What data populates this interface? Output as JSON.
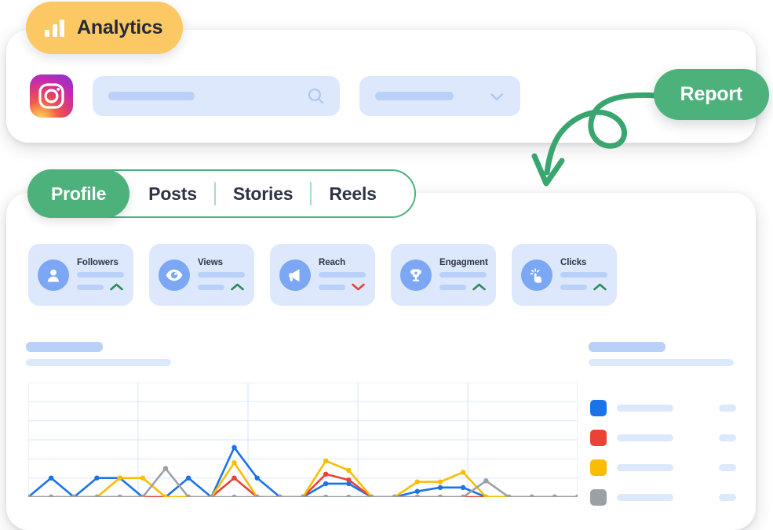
{
  "badge": {
    "label": "Analytics",
    "icon": "bar-chart-icon",
    "bg_color": "#fcc863"
  },
  "top_panel": {
    "platform_icon": "instagram-icon",
    "search": {
      "icon": "search-icon",
      "value": "",
      "placeholder": ""
    },
    "dropdown": {
      "icon": "chevron-down-icon",
      "value": ""
    },
    "report_button": {
      "label": "Report",
      "color": "#4cb17b"
    },
    "arrow": {
      "name": "curved-arrow-annotation",
      "color": "#3aa66f"
    }
  },
  "tabs": [
    {
      "label": "Profile",
      "active": true
    },
    {
      "label": "Posts",
      "active": false
    },
    {
      "label": "Stories",
      "active": false
    },
    {
      "label": "Reels",
      "active": false
    }
  ],
  "stat_cards": [
    {
      "label": "Followers",
      "icon": "user-icon",
      "trend": "up",
      "trend_color": "#2e8b57"
    },
    {
      "label": "Views",
      "icon": "eye-icon",
      "trend": "up",
      "trend_color": "#2e8b57"
    },
    {
      "label": "Reach",
      "icon": "megaphone-icon",
      "trend": "down",
      "trend_color": "#e8413a"
    },
    {
      "label": "Engagment",
      "icon": "trophy-icon",
      "trend": "up",
      "trend_color": "#2e8b57"
    },
    {
      "label": "Clicks",
      "icon": "tap-click-icon",
      "trend": "up",
      "trend_color": "#2e8b57"
    }
  ],
  "chart_data": {
    "type": "line",
    "title": "",
    "subtitle": "",
    "xlabel": "",
    "ylabel": "",
    "grid": true,
    "grid_rows": 6,
    "grid_cols": 5,
    "xlim": [
      0,
      24
    ],
    "ylim": [
      0,
      6
    ],
    "legend_position": "right",
    "x": [
      0,
      1,
      2,
      3,
      4,
      5,
      6,
      7,
      8,
      9,
      10,
      11,
      12,
      13,
      14,
      15,
      16,
      17,
      18,
      19,
      20,
      21,
      22,
      23,
      24
    ],
    "series": [
      {
        "name": "",
        "color": "#1a73e8",
        "values": [
          0,
          1,
          0,
          1,
          1,
          0,
          0,
          1,
          0,
          2.6,
          1,
          0,
          0,
          0.7,
          0.7,
          0,
          0,
          0.3,
          0.5,
          0.5,
          0,
          0,
          0,
          0,
          0
        ]
      },
      {
        "name": "",
        "color": "#ea4335",
        "values": [
          0,
          0,
          0,
          0,
          0,
          0,
          0,
          0,
          0,
          1,
          0,
          0,
          0,
          1.2,
          0.9,
          0,
          0,
          0,
          0,
          0,
          0,
          0,
          0,
          0,
          0
        ]
      },
      {
        "name": "",
        "color": "#fbbc04",
        "values": [
          0,
          0,
          0,
          0,
          1,
          1,
          0,
          0,
          0,
          1.8,
          0,
          0,
          0,
          1.9,
          1.4,
          0,
          0,
          0.8,
          0.8,
          1.3,
          0,
          0,
          0,
          0,
          0
        ]
      },
      {
        "name": "",
        "color": "#9aa0a6",
        "values": [
          0,
          0,
          0,
          0,
          0,
          0,
          1.5,
          0,
          0,
          0,
          0,
          0,
          0,
          0,
          0,
          0,
          0,
          0,
          0,
          0,
          0.85,
          0,
          0,
          0,
          0
        ]
      }
    ],
    "legend": [
      {
        "color": "#1a73e8",
        "label": "",
        "value": ""
      },
      {
        "color": "#ea4335",
        "label": "",
        "value": ""
      },
      {
        "color": "#fbbc04",
        "label": "",
        "value": ""
      },
      {
        "color": "#9aa0a6",
        "label": "",
        "value": ""
      }
    ]
  }
}
